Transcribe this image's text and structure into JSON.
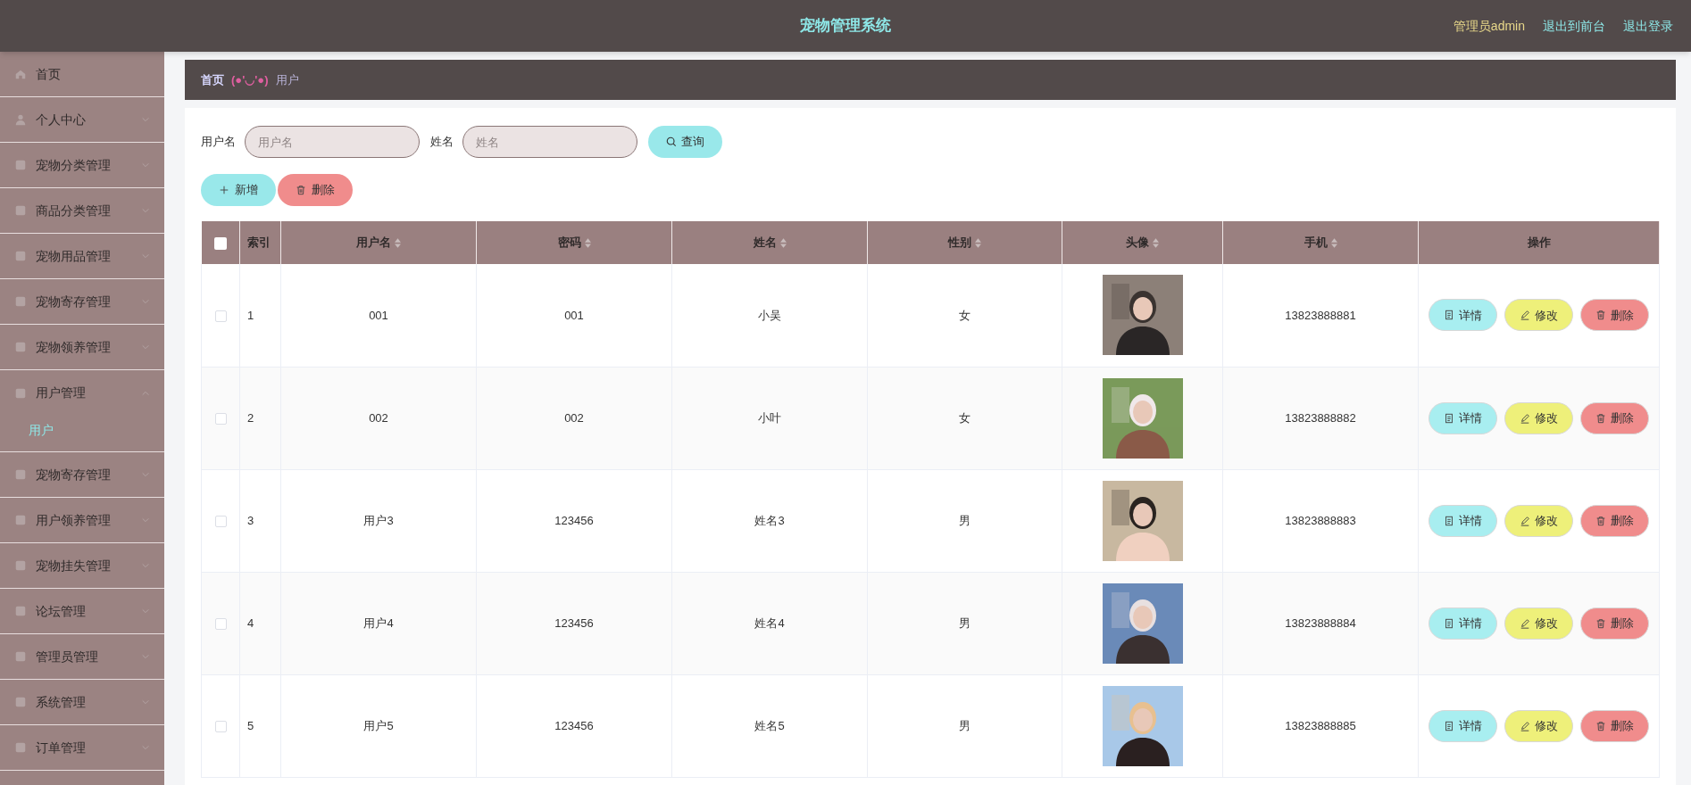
{
  "header": {
    "title": "宠物管理系统",
    "user": "管理员admin",
    "links": [
      "退出到前台",
      "退出登录"
    ]
  },
  "sidebar": {
    "items": [
      {
        "label": "首页",
        "expanded": false
      },
      {
        "label": "个人中心",
        "expanded": false
      },
      {
        "label": "宠物分类管理",
        "expanded": false
      },
      {
        "label": "商品分类管理",
        "expanded": false
      },
      {
        "label": "宠物用品管理",
        "expanded": false
      },
      {
        "label": "宠物寄存管理",
        "expanded": false
      },
      {
        "label": "宠物领养管理",
        "expanded": false
      },
      {
        "label": "用户管理",
        "expanded": true,
        "children": [
          {
            "label": "用户",
            "selected": true
          }
        ]
      },
      {
        "label": "宠物寄存管理",
        "expanded": false
      },
      {
        "label": "用户领养管理",
        "expanded": false
      },
      {
        "label": "宠物挂失管理",
        "expanded": false
      },
      {
        "label": "论坛管理",
        "expanded": false
      },
      {
        "label": "管理员管理",
        "expanded": false
      },
      {
        "label": "系统管理",
        "expanded": false
      },
      {
        "label": "订单管理",
        "expanded": false
      }
    ]
  },
  "breadcrumb": {
    "home": "首页",
    "separator": "(●'◡'●)",
    "current": "用户"
  },
  "search": {
    "fields": [
      {
        "label": "用户名",
        "placeholder": "用户名"
      },
      {
        "label": "姓名",
        "placeholder": "姓名"
      }
    ],
    "button": "查询"
  },
  "actions": [
    {
      "kind": "add",
      "label": "新增"
    },
    {
      "kind": "delete",
      "label": "删除"
    }
  ],
  "table": {
    "select_all_checked": false,
    "columns": [
      {
        "label": "索引",
        "sortable": false
      },
      {
        "label": "用户名",
        "sortable": true
      },
      {
        "label": "密码",
        "sortable": true
      },
      {
        "label": "姓名",
        "sortable": true
      },
      {
        "label": "性别",
        "sortable": true
      },
      {
        "label": "头像",
        "sortable": true
      },
      {
        "label": "手机",
        "sortable": true
      },
      {
        "label": "操作",
        "sortable": false
      }
    ],
    "rows": [
      {
        "checked": false,
        "cells": [
          "1",
          "001",
          "001",
          "小吴",
          "女"
        ],
        "phone": "13823888881",
        "buttons": [
          {
            "kind": "detail",
            "label": "详情"
          },
          {
            "kind": "edit",
            "label": "修改"
          },
          {
            "kind": "delete",
            "label": "删除"
          }
        ]
      },
      {
        "checked": false,
        "cells": [
          "2",
          "002",
          "002",
          "小叶",
          "女"
        ],
        "phone": "13823888882",
        "buttons": [
          {
            "kind": "detail",
            "label": "详情"
          },
          {
            "kind": "edit",
            "label": "修改"
          },
          {
            "kind": "delete",
            "label": "删除"
          }
        ]
      },
      {
        "checked": false,
        "cells": [
          "3",
          "用户3",
          "123456",
          "姓名3",
          "男"
        ],
        "phone": "13823888883",
        "buttons": [
          {
            "kind": "detail",
            "label": "详情"
          },
          {
            "kind": "edit",
            "label": "修改"
          },
          {
            "kind": "delete",
            "label": "删除"
          }
        ]
      },
      {
        "checked": false,
        "cells": [
          "4",
          "用户4",
          "123456",
          "姓名4",
          "男"
        ],
        "phone": "13823888884",
        "buttons": [
          {
            "kind": "detail",
            "label": "详情"
          },
          {
            "kind": "edit",
            "label": "修改"
          },
          {
            "kind": "delete",
            "label": "删除"
          }
        ]
      },
      {
        "checked": false,
        "cells": [
          "5",
          "用户5",
          "123456",
          "姓名5",
          "男"
        ],
        "phone": "13823888885",
        "buttons": [
          {
            "kind": "detail",
            "label": "详情"
          },
          {
            "kind": "edit",
            "label": "修改"
          },
          {
            "kind": "delete",
            "label": "删除"
          }
        ]
      }
    ]
  }
}
